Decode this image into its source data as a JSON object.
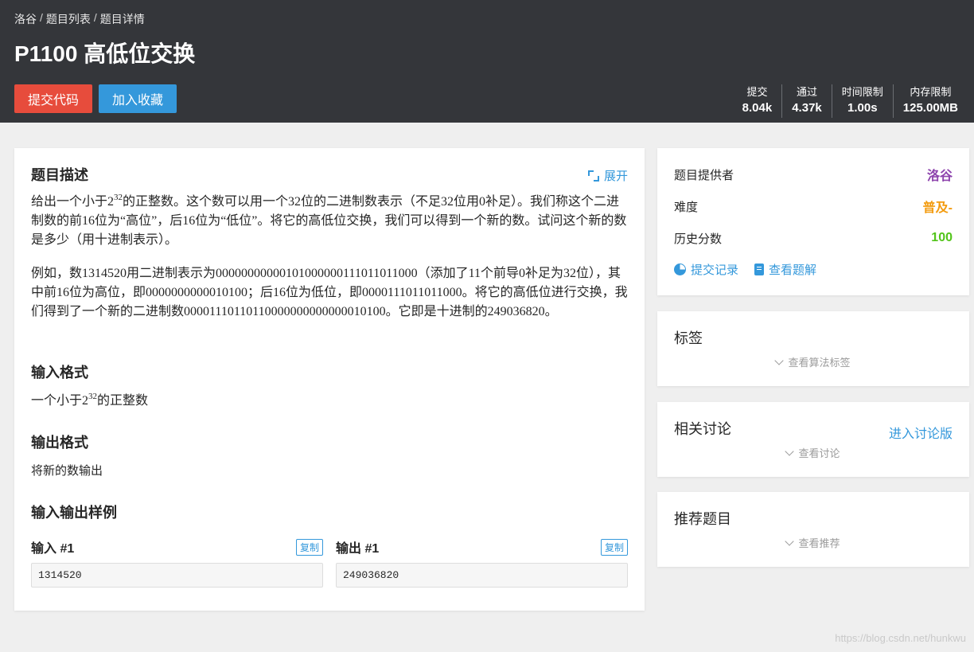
{
  "header": {
    "breadcrumb": [
      "洛谷",
      "题目列表",
      "题目详情"
    ],
    "breadcrumb_sep": "/",
    "title": "P1100 高低位交换",
    "submit_label": "提交代码",
    "favorite_label": "加入收藏",
    "stats": [
      {
        "label": "提交",
        "value": "8.04k"
      },
      {
        "label": "通过",
        "value": "4.37k"
      },
      {
        "label": "时间限制",
        "value": "1.00s"
      },
      {
        "label": "内存限制",
        "value": "125.00MB"
      }
    ]
  },
  "problem": {
    "desc_title": "题目描述",
    "expand_label": "展开",
    "desc_p1_a": "给出一个小于",
    "desc_p1_base": "2",
    "desc_p1_exp": "32",
    "desc_p1_b": "的正整数。这个数可以用一个32位的二进制数表示（不足32位用0补足）。我们称这个二进制数的前16位为“高位”，后16位为“低位”。将它的高低位交换，我们可以得到一个新的数。试问这个新的数是多少（用十进制表示）。",
    "desc_p2": "例如，数1314520用二进制表示为0000000000010100000011101101100​0（添加了11个前导0补足为32位），其中前16位为高位，即0000000000010100；后16位为低位，即0000111011011000。将它的高低位进行交换，我们得到了一个新的二进制数0000111011011000000000000001010​0。它即是十进制的249036820。",
    "input_title": "输入格式",
    "input_a": "一个小于",
    "input_base": "2",
    "input_exp": "32",
    "input_b": "的正整数",
    "output_title": "输出格式",
    "output_text": "将新的数输出",
    "sample_title": "输入输出样例",
    "samples": {
      "input_label": "输入 #1",
      "output_label": "输出 #1",
      "copy_label": "复制",
      "input_value": "1314520",
      "output_value": "249036820"
    }
  },
  "sidebar": {
    "info": [
      {
        "label": "题目提供者",
        "value": "洛谷",
        "color": "#8e44ad"
      },
      {
        "label": "难度",
        "value": "普及-",
        "color": "#f39c11"
      },
      {
        "label": "历史分数",
        "value": "100",
        "color": "#52c41a"
      }
    ],
    "submit_records": "提交记录",
    "view_solutions": "查看题解",
    "tags_title": "标签",
    "tags_more": "查看算法标签",
    "discuss_title": "相关讨论",
    "discuss_link": "进入讨论版",
    "discuss_more": "查看讨论",
    "recommend_title": "推荐题目",
    "recommend_more": "查看推荐"
  },
  "watermark": "https://blog.csdn.net/hunkwu",
  "colors": {
    "accent": "#3498db",
    "danger": "#e74c3c",
    "header_bg": "#34363a"
  }
}
